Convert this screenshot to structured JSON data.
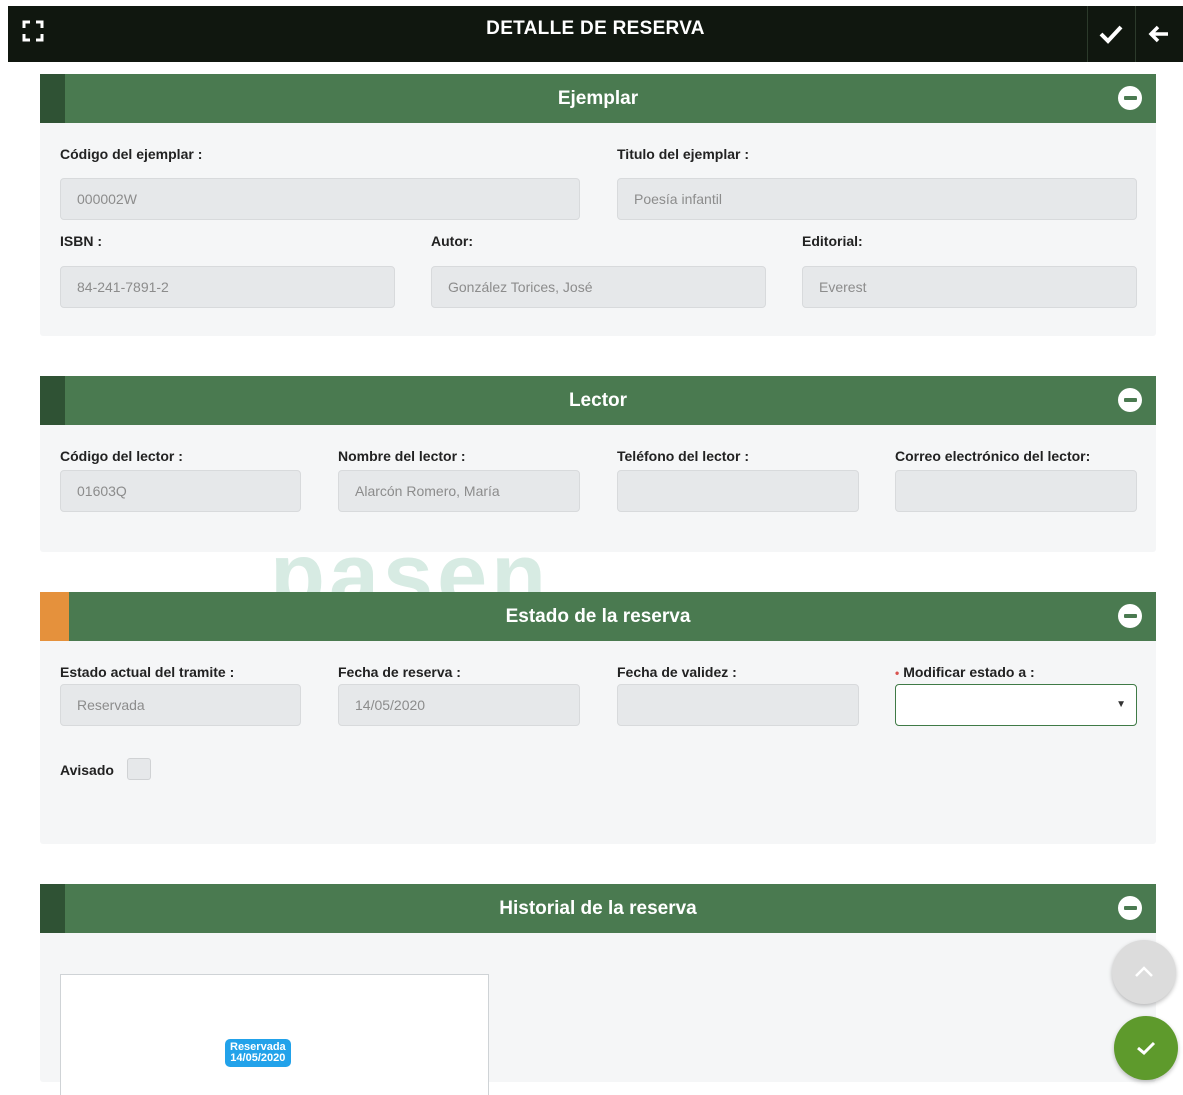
{
  "header": {
    "title": "DETALLE DE RESERVA"
  },
  "panels": {
    "ejemplar": {
      "title": "Ejemplar",
      "codigo_label": "Código del ejemplar :",
      "codigo_value": "000002W",
      "titulo_label": "Titulo del ejemplar :",
      "titulo_value": "Poesía infantil",
      "isbn_label": "ISBN :",
      "isbn_value": "84-241-7891-2",
      "autor_label": "Autor:",
      "autor_value": "González Torices, José",
      "editorial_label": "Editorial:",
      "editorial_value": "Everest"
    },
    "lector": {
      "title": "Lector",
      "codigo_label": "Código del lector :",
      "codigo_value": "01603Q",
      "nombre_label": "Nombre del lector :",
      "nombre_value": "Alarcón Romero, María",
      "telefono_label": "Teléfono del lector :",
      "telefono_value": "",
      "correo_label": "Correo electrónico del lector:",
      "correo_value": ""
    },
    "estado": {
      "title": "Estado de la reserva",
      "estado_actual_label": "Estado actual del tramite :",
      "estado_actual_value": "Reservada",
      "fecha_reserva_label": "Fecha de reserva :",
      "fecha_reserva_value": "14/05/2020",
      "fecha_validez_label": "Fecha de validez :",
      "fecha_validez_value": "",
      "required_mark": "•",
      "modificar_label": "Modificar estado a :",
      "modificar_value": "",
      "avisado_label": "Avisado"
    },
    "historial": {
      "title": "Historial de la reserva",
      "badge_status": "Reservada",
      "badge_date": "14/05/2020"
    }
  },
  "watermark": "pasen",
  "colors": {
    "topbar": "#10170f",
    "panel_header": "#4a7a50",
    "panel_accent": "#2f5234",
    "estado_accent": "#e5913c",
    "badge": "#22a2ea",
    "fab_confirm": "#5e9a2c"
  },
  "icons": {
    "fullscreen": "fullscreen-icon",
    "save": "check-icon",
    "back": "arrow-left-icon",
    "collapse": "minus-circle-icon",
    "scroll_top": "chevron-up-icon",
    "confirm": "check-icon"
  }
}
